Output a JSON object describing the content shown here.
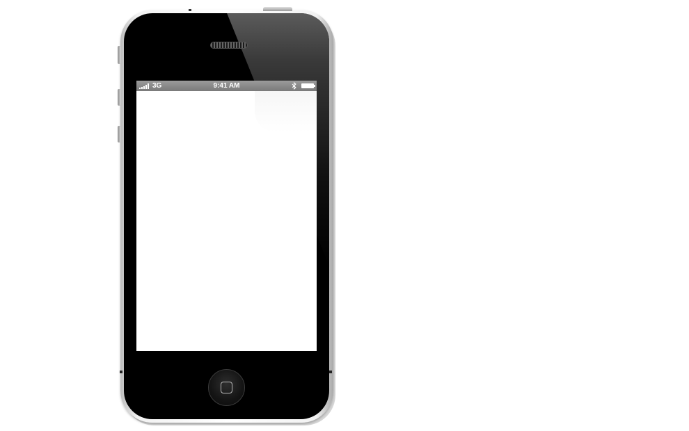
{
  "status_bar": {
    "carrier": "3G",
    "time": "9:41 AM",
    "signal_bars": 5,
    "bluetooth_icon": "bluetooth-icon",
    "battery_icon": "battery-icon",
    "battery_level": 1.0
  },
  "device": {
    "home_button_icon": "home-square-icon",
    "speaker_icon": "speaker-grille",
    "screen_content": ""
  },
  "colors": {
    "status_bar": "#8a8a8a",
    "body": "#000000",
    "screen": "#ffffff",
    "band": "#e8e8e8"
  }
}
